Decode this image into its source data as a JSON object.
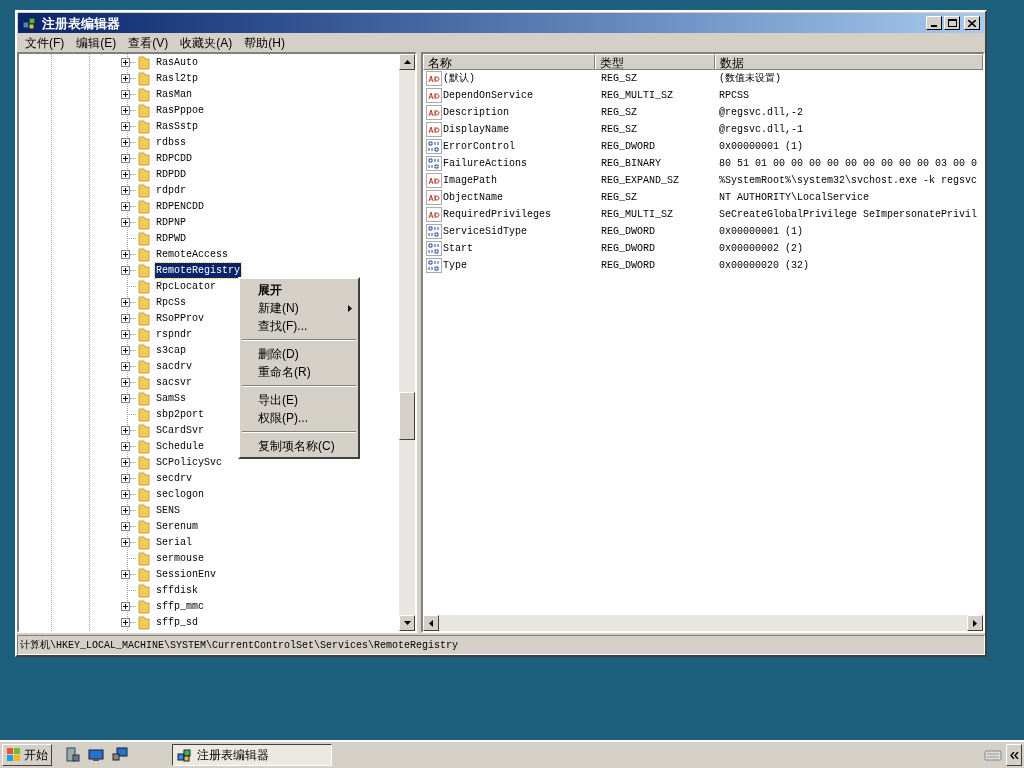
{
  "window": {
    "title": "注册表编辑器"
  },
  "menu": [
    "文件(F)",
    "编辑(E)",
    "查看(V)",
    "收藏夹(A)",
    "帮助(H)"
  ],
  "tree": [
    {
      "name": "RasAuto",
      "expandable": true,
      "selected": false
    },
    {
      "name": "Rasl2tp",
      "expandable": true,
      "selected": false
    },
    {
      "name": "RasMan",
      "expandable": true,
      "selected": false
    },
    {
      "name": "RasPppoe",
      "expandable": true,
      "selected": false
    },
    {
      "name": "RasSstp",
      "expandable": true,
      "selected": false
    },
    {
      "name": "rdbss",
      "expandable": true,
      "selected": false
    },
    {
      "name": "RDPCDD",
      "expandable": true,
      "selected": false
    },
    {
      "name": "RDPDD",
      "expandable": true,
      "selected": false
    },
    {
      "name": "rdpdr",
      "expandable": true,
      "selected": false
    },
    {
      "name": "RDPENCDD",
      "expandable": true,
      "selected": false
    },
    {
      "name": "RDPNP",
      "expandable": true,
      "selected": false
    },
    {
      "name": "RDPWD",
      "expandable": false,
      "selected": false
    },
    {
      "name": "RemoteAccess",
      "expandable": true,
      "selected": false
    },
    {
      "name": "RemoteRegistry",
      "expandable": true,
      "selected": true
    },
    {
      "name": "RpcLocator",
      "expandable": false,
      "selected": false
    },
    {
      "name": "RpcSs",
      "expandable": true,
      "selected": false
    },
    {
      "name": "RSoPProv",
      "expandable": true,
      "selected": false
    },
    {
      "name": "rspndr",
      "expandable": true,
      "selected": false
    },
    {
      "name": "s3cap",
      "expandable": true,
      "selected": false
    },
    {
      "name": "sacdrv",
      "expandable": true,
      "selected": false
    },
    {
      "name": "sacsvr",
      "expandable": true,
      "selected": false
    },
    {
      "name": "SamSs",
      "expandable": true,
      "selected": false
    },
    {
      "name": "sbp2port",
      "expandable": false,
      "selected": false
    },
    {
      "name": "SCardSvr",
      "expandable": true,
      "selected": false
    },
    {
      "name": "Schedule",
      "expandable": true,
      "selected": false
    },
    {
      "name": "SCPolicySvc",
      "expandable": true,
      "selected": false
    },
    {
      "name": "secdrv",
      "expandable": true,
      "selected": false
    },
    {
      "name": "seclogon",
      "expandable": true,
      "selected": false
    },
    {
      "name": "SENS",
      "expandable": true,
      "selected": false
    },
    {
      "name": "Serenum",
      "expandable": true,
      "selected": false
    },
    {
      "name": "Serial",
      "expandable": true,
      "selected": false
    },
    {
      "name": "sermouse",
      "expandable": false,
      "selected": false
    },
    {
      "name": "SessionEnv",
      "expandable": true,
      "selected": false
    },
    {
      "name": "sffdisk",
      "expandable": false,
      "selected": false
    },
    {
      "name": "sffp_mmc",
      "expandable": true,
      "selected": false
    },
    {
      "name": "sffp_sd",
      "expandable": true,
      "selected": false
    }
  ],
  "context_menu": [
    {
      "kind": "item",
      "label": "展开",
      "default": true,
      "submenu": false
    },
    {
      "kind": "item",
      "label": "新建(N)",
      "default": false,
      "submenu": true
    },
    {
      "kind": "item",
      "label": "查找(F)...",
      "default": false,
      "submenu": false
    },
    {
      "kind": "separator"
    },
    {
      "kind": "item",
      "label": "删除(D)",
      "default": false,
      "submenu": false
    },
    {
      "kind": "item",
      "label": "重命名(R)",
      "default": false,
      "submenu": false
    },
    {
      "kind": "separator"
    },
    {
      "kind": "item",
      "label": "导出(E)",
      "default": false,
      "submenu": false
    },
    {
      "kind": "item",
      "label": "权限(P)...",
      "default": false,
      "submenu": false
    },
    {
      "kind": "separator"
    },
    {
      "kind": "item",
      "label": "复制项名称(C)",
      "default": false,
      "submenu": false
    }
  ],
  "values": {
    "columns": [
      "名称",
      "类型",
      "数据"
    ],
    "rows": [
      {
        "kind": "string",
        "name": "(默认)",
        "type": "REG_SZ",
        "data": "(数值未设置)"
      },
      {
        "kind": "string",
        "name": "DependOnService",
        "type": "REG_MULTI_SZ",
        "data": "RPCSS"
      },
      {
        "kind": "string",
        "name": "Description",
        "type": "REG_SZ",
        "data": "@regsvc.dll,-2"
      },
      {
        "kind": "string",
        "name": "DisplayName",
        "type": "REG_SZ",
        "data": "@regsvc.dll,-1"
      },
      {
        "kind": "binary",
        "name": "ErrorControl",
        "type": "REG_DWORD",
        "data": "0x00000001 (1)"
      },
      {
        "kind": "binary",
        "name": "FailureActions",
        "type": "REG_BINARY",
        "data": "80 51 01 00 00 00 00 00 00 00 00 00 03 00 0"
      },
      {
        "kind": "string",
        "name": "ImagePath",
        "type": "REG_EXPAND_SZ",
        "data": "%SystemRoot%\\system32\\svchost.exe -k regsvc"
      },
      {
        "kind": "string",
        "name": "ObjectName",
        "type": "REG_SZ",
        "data": "NT AUTHORITY\\LocalService"
      },
      {
        "kind": "string",
        "name": "RequiredPrivileges",
        "type": "REG_MULTI_SZ",
        "data": "SeCreateGlobalPrivilege SeImpersonatePrivil"
      },
      {
        "kind": "binary",
        "name": "ServiceSidType",
        "type": "REG_DWORD",
        "data": "0x00000001 (1)"
      },
      {
        "kind": "binary",
        "name": "Start",
        "type": "REG_DWORD",
        "data": "0x00000002 (2)"
      },
      {
        "kind": "binary",
        "name": "Type",
        "type": "REG_DWORD",
        "data": "0x00000020 (32)"
      }
    ]
  },
  "status_bar": "计算机\\HKEY_LOCAL_MACHINE\\SYSTEM\\CurrentControlSet\\Services\\RemoteRegistry",
  "taskbar": {
    "start": "开始",
    "task": "注册表编辑器"
  }
}
